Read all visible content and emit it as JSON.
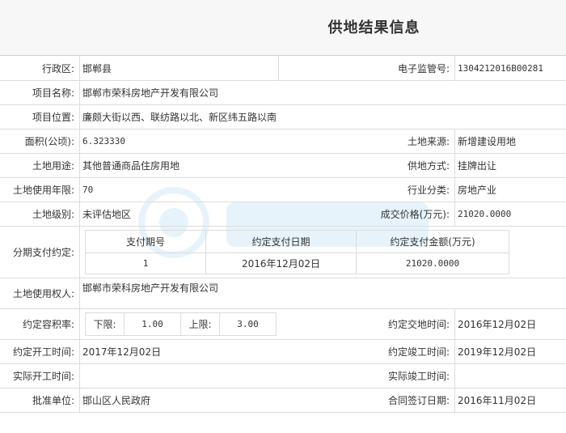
{
  "title": "供地结果信息",
  "rows": {
    "district_label": "行政区:",
    "district": "邯郸县",
    "supervision_label": "电子监管号:",
    "supervision_no": "1304212016B00281",
    "project_name_label": "项目名称:",
    "project_name": "邯郸市荣科房地产开发有限公司",
    "project_location_label": "项目位置:",
    "project_location": "廉颇大街以西、联纺路以北、新区纬五路以南",
    "area_label": "面积(公顷):",
    "area": "6.323330",
    "land_source_label": "土地来源:",
    "land_source": "新增建设用地",
    "land_use_label": "土地用途:",
    "land_use": "其他普通商品住房用地",
    "supply_method_label": "供地方式:",
    "supply_method": "挂牌出让",
    "use_years_label": "土地使用年限:",
    "use_years": "70",
    "industry_label": "行业分类:",
    "industry": "房地产业",
    "land_level_label": "土地级别:",
    "land_level": "未评估地区",
    "deal_price_label": "成交价格(万元):",
    "deal_price": "21020.0000",
    "installment_label": "分期支付约定:",
    "installment_headers": [
      "支付期号",
      "约定支付日期",
      "约定支付金额(万元)"
    ],
    "installment_row": [
      "1",
      "2016年12月02日",
      "21020.0000"
    ],
    "land_user_label": "土地使用权人:",
    "land_user": "邯郸市荣科房地产开发有限公司",
    "far_label": "约定容积率:",
    "far_lower_label": "下限:",
    "far_lower": "1.00",
    "far_upper_label": "上限:",
    "far_upper": "3.00",
    "handover_label": "约定交地时间:",
    "handover": "2016年12月02日",
    "start_label": "约定开工时间:",
    "start": "2017年12月02日",
    "finish_label": "约定竣工时间:",
    "finish": "2019年12月02日",
    "actual_start_label": "实际开工时间:",
    "actual_start": "",
    "actual_finish_label": "实际竣工时间:",
    "actual_finish": "",
    "approver_label": "批准单位:",
    "approver": "邯山区人民政府",
    "contract_date_label": "合同签订日期:",
    "contract_date": "2016年11月02日"
  },
  "colors": {
    "border": "#dcdcdc",
    "header_bg": "#f7f7f7"
  }
}
